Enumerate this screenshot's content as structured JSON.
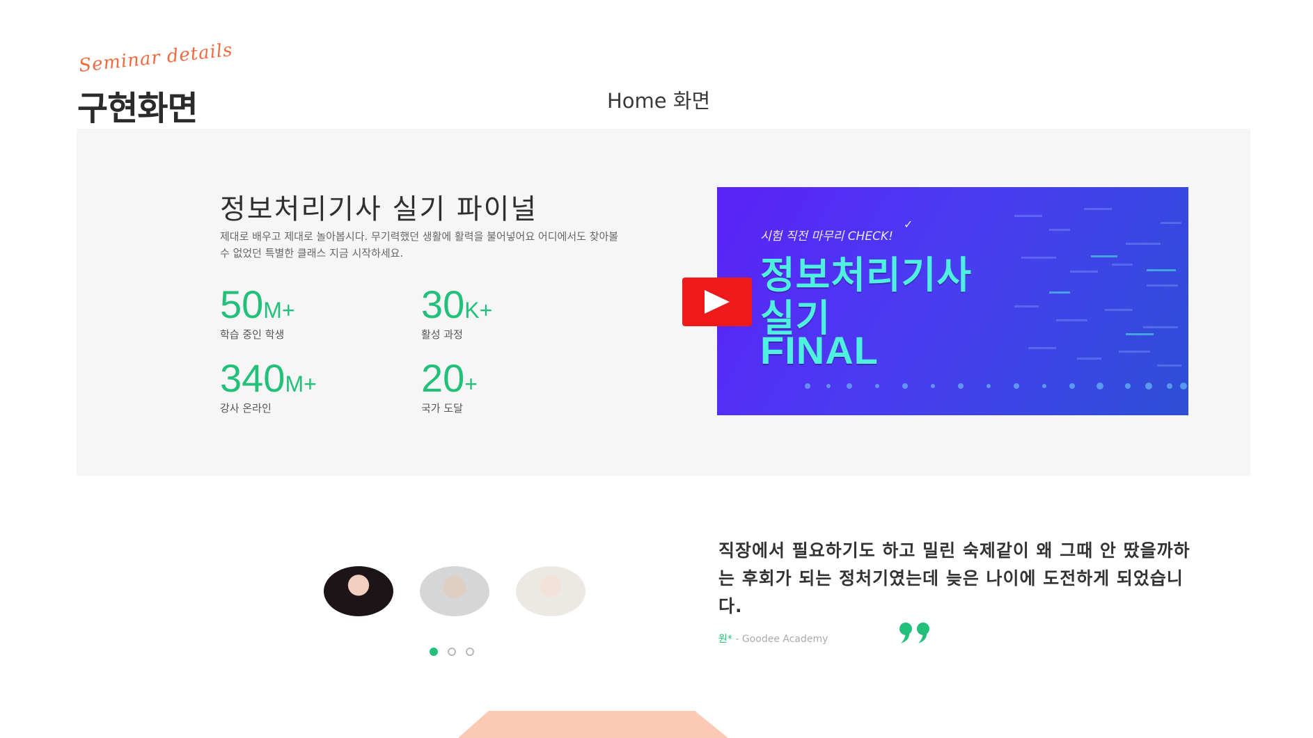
{
  "heading": {
    "script_label": "Seminar details",
    "title": "구현화면"
  },
  "page_caption": "Home 화면",
  "hero": {
    "course_title": "정보처리기사 실기 파이널",
    "description": "제대로 배우고 제대로 놀아봅시다. 무기력했던 생활에 활력을 불어넣어요 어디에서도 찾아볼 수 없었던 특별한 클래스 지금 시작하세요.",
    "stats": [
      {
        "number": "50",
        "suffix": "M+",
        "label": "학습 중인 학생"
      },
      {
        "number": "30",
        "suffix": "K+",
        "label": "활성 과정"
      },
      {
        "number": "340",
        "suffix": "M+",
        "label": "강사 온라인"
      },
      {
        "number": "20",
        "suffix": "+",
        "label": "국가 도달"
      }
    ],
    "video": {
      "small_caption": "시험 직전 마무리 CHECK!",
      "line1": "정보처리기사",
      "line2": "실기",
      "line3": "FINAL"
    }
  },
  "testimonial": {
    "text": "직장에서 필요하기도 하고 밀린 숙제같이 왜 그때 안 땄을까하는 후회가 되는 정처기였는데 늦은 나이에 도전하게 되었습니다.",
    "author_name": "원*",
    "author_org": " - Goodee Academy",
    "active_slide": 1,
    "slide_count": 3
  },
  "colors": {
    "accent_green": "#22c07a",
    "script_orange": "#ef6a3f",
    "play_red": "#ee1a1a",
    "hero_bg": "#f6f6f6",
    "deco_peach": "#fcc9b5"
  },
  "icons": [
    "play-icon",
    "quote-icon",
    "check-icon"
  ]
}
